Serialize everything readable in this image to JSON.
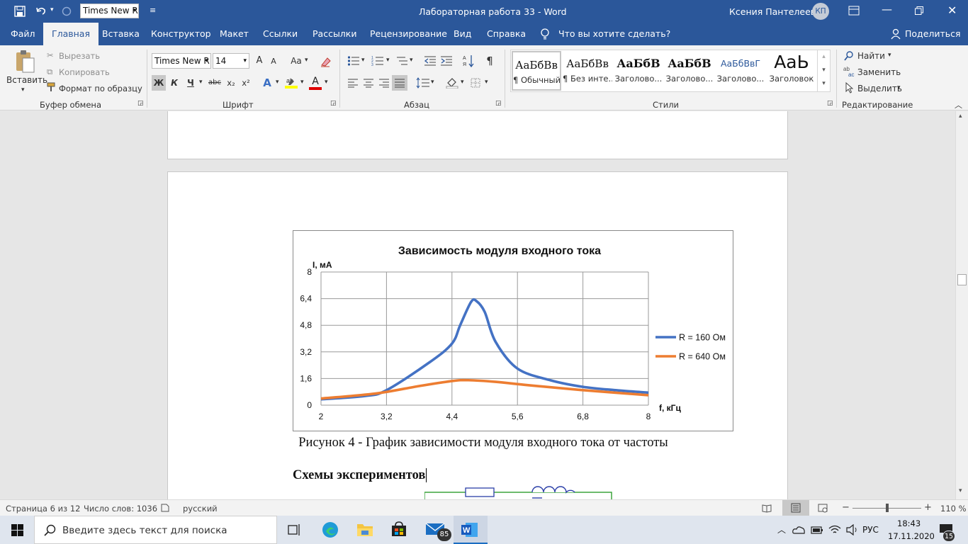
{
  "titlebar": {
    "font_box": "Times New R",
    "title": "Лабораторная работа 33  -  Word",
    "user": "Ксения Пантелеева",
    "user_initials": "КП"
  },
  "tabs": [
    "Файл",
    "Главная",
    "Вставка",
    "Конструктор",
    "Макет",
    "Ссылки",
    "Рассылки",
    "Рецензирование",
    "Вид",
    "Справка"
  ],
  "tell_me": "Что вы хотите сделать?",
  "share": "Поделиться",
  "ribbon": {
    "clipboard": {
      "paste": "Вставить",
      "cut": "Вырезать",
      "copy": "Копировать",
      "format_painter": "Формат по образцу",
      "label": "Буфер обмена"
    },
    "font": {
      "name": "Times New R",
      "size": "14",
      "bold": "Ж",
      "italic": "К",
      "underline": "Ч",
      "strike": "abc",
      "sub": "x₂",
      "sup": "x²",
      "grow": "A",
      "shrink": "A",
      "case": "Aa",
      "font_color": "A",
      "effects": "A",
      "label": "Шрифт"
    },
    "paragraph": {
      "label": "Абзац",
      "show_marks": "¶"
    },
    "styles": {
      "items": [
        {
          "sample": "АаБбВв",
          "name": "¶ Обычный"
        },
        {
          "sample": "АаБбВв",
          "name": "¶ Без инте..."
        },
        {
          "sample": "АаБбВ",
          "name": "Заголово..."
        },
        {
          "sample": "АаБбВ",
          "name": "Заголово..."
        },
        {
          "sample": "АаБбВвГ",
          "name": "Заголово..."
        },
        {
          "sample": "АаЬ",
          "name": "Заголовок"
        }
      ],
      "label": "Стили"
    },
    "editing": {
      "find": "Найти",
      "replace": "Заменить",
      "select": "Выделить",
      "label": "Редактирование"
    }
  },
  "document": {
    "caption": "Рисунок 4 - График зависимости модуля входного тока от частоты",
    "heading": "Схемы экспериментов"
  },
  "chart_data": {
    "type": "line",
    "title": "Зависимость модуля входного тока",
    "xlabel": "f, кГц",
    "ylabel": "I, мА",
    "xlim": [
      2,
      8
    ],
    "ylim": [
      0,
      8
    ],
    "xticks": [
      "2",
      "3,2",
      "4,4",
      "5,6",
      "6,8",
      "8"
    ],
    "yticks": [
      "0",
      "1,6",
      "3,2",
      "4,8",
      "6,4",
      "8"
    ],
    "grid": true,
    "legend_position": "right",
    "series": [
      {
        "name": "R = 160 Ом",
        "color": "#4472c4",
        "x": [
          2.0,
          2.8,
          3.2,
          4.0,
          4.4,
          4.55,
          4.75,
          4.85,
          5.0,
          5.2,
          5.6,
          6.2,
          6.8,
          7.4,
          8.0
        ],
        "y": [
          0.35,
          0.55,
          0.9,
          2.6,
          3.7,
          4.8,
          6.2,
          6.25,
          5.6,
          3.8,
          2.2,
          1.5,
          1.1,
          0.9,
          0.75
        ]
      },
      {
        "name": "R = 640 Ом",
        "color": "#ed7d31",
        "x": [
          2.0,
          3.0,
          3.8,
          4.4,
          4.7,
          5.2,
          5.8,
          6.8,
          8.0
        ],
        "y": [
          0.4,
          0.7,
          1.15,
          1.45,
          1.5,
          1.4,
          1.2,
          0.9,
          0.6
        ]
      }
    ]
  },
  "status": {
    "page": "Страница 6 из 12",
    "words": "Число слов: 1036",
    "lang": "русский",
    "zoom": "110 %"
  },
  "taskbar": {
    "search": "Введите здесь текст для поиска",
    "lang": "РУС",
    "time": "18:43",
    "date": "17.11.2020",
    "mail_badge": "85",
    "notif_badge": "15"
  }
}
